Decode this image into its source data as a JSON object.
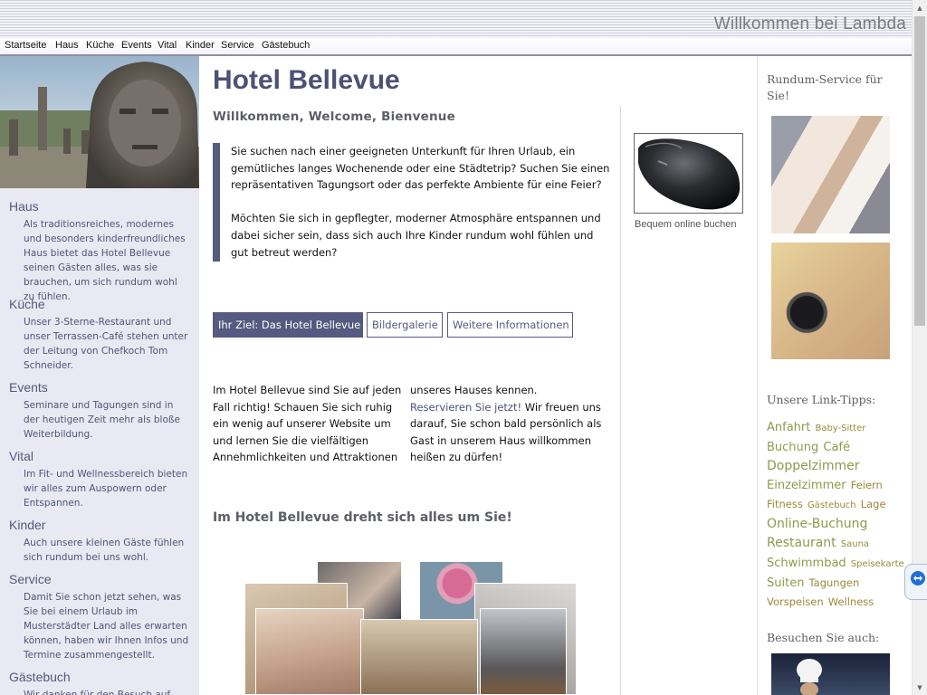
{
  "header": {
    "title": "Willkommen bei Lambda"
  },
  "topnav": [
    "Startseite",
    "Haus",
    "Küche",
    "Events",
    "Vital",
    "Kinder",
    "Service",
    "Gästebuch"
  ],
  "sidebar": {
    "sections": [
      {
        "title": "Haus",
        "text": "Als traditionsreiches, modernes und besonders kinderfreundliches Haus bietet das Hotel Bellevue seinen Gästen alles, was sie brauchen, um sich rundum wohl zu fühlen."
      },
      {
        "title": "Küche",
        "text": "Unser 3-Sterne-Restaurant und unser Terrassen-Café stehen unter der Leitung von Chefkoch Tom Schneider."
      },
      {
        "title": "Events",
        "text": "Seminare und Tagungen sind in der heutigen Zeit mehr als bloße Weiterbildung."
      },
      {
        "title": "Vital",
        "text": "Im Fit- und Wellnessbereich bieten wir alles zum Auspowern oder Entspannen."
      },
      {
        "title": "Kinder",
        "text": "Auch unsere kleinen Gäste fühlen sich rundum bei uns wohl."
      },
      {
        "title": "Service",
        "text": "Damit Sie schon jetzt sehen, was Sie bei einem Urlaub im Musterstädter Land alles erwarten können, haben wir Ihnen Infos und Termine zusammengestellt."
      },
      {
        "title": "Gästebuch",
        "text": "Wir danken für den Besuch auf"
      }
    ]
  },
  "main": {
    "title": "Hotel Bellevue",
    "subtitle": "Willkommen, Welcome, Bienvenue",
    "intro_p1": "Sie suchen nach einer geeigneten Unterkunft für Ihren Urlaub, ein gemütliches langes Wochenende oder eine Städtetrip? Suchen Sie einen repräsentativen Tagungsort oder das perfekte Ambiente für eine Feier?",
    "intro_p2": "Möchten Sie sich in gepflegter, moderner Atmosphäre entspannen und dabei sicher sein, dass sich auch Ihre Kinder rundum wohl fühlen und gut betreut werden?",
    "tabs": [
      "Ihr Ziel: Das Hotel Bellevue",
      "Bildergalerie",
      "Weitere Informationen"
    ],
    "col1": "Im Hotel Bellevue sind Sie auf jeden Fall richtig! Schauen Sie sich ruhig ein wenig auf unserer Website um und lernen Sie die vielfältigen Annehmlichkeiten und Attraktionen",
    "col2_a": "unseres Hauses kennen. ",
    "col2_link": "Reservieren Sie jetzt!",
    "col2_b": " Wir freuen uns darauf, Sie schon bald persönlich als Gast in unserem Haus willkommen heißen zu dürfen!",
    "heading2": "Im Hotel Bellevue dreht sich alles um Sie!",
    "booking_caption": "Bequem online buchen"
  },
  "right": {
    "service_title": "Rundum-Service für Sie!",
    "links_title": "Unsere Link-Tipps:",
    "tags": [
      {
        "text": "Anfahrt",
        "size": "l"
      },
      {
        "text": "Baby-Sitter",
        "size": "s"
      },
      {
        "text": "Buchung",
        "size": "l"
      },
      {
        "text": "Café",
        "size": "l"
      },
      {
        "text": "Doppelzimmer",
        "size": "xl"
      },
      {
        "text": "Einzelzimmer",
        "size": "l"
      },
      {
        "text": "Feiern",
        "size": "m"
      },
      {
        "text": "Fitness",
        "size": "m"
      },
      {
        "text": "Gästebuch",
        "size": "s"
      },
      {
        "text": "Lage",
        "size": "m"
      },
      {
        "text": "Online-Buchung",
        "size": "xl"
      },
      {
        "text": "Restaurant",
        "size": "xl"
      },
      {
        "text": "Sauna",
        "size": "s"
      },
      {
        "text": "Schwimmbad",
        "size": "l"
      },
      {
        "text": "Speisekarte",
        "size": "s"
      },
      {
        "text": "Suiten",
        "size": "l"
      },
      {
        "text": "Tagungen",
        "size": "m"
      },
      {
        "text": "Vorspeisen",
        "size": "m"
      },
      {
        "text": "Wellness",
        "size": "m"
      }
    ],
    "visit_title": "Besuchen Sie auch:"
  },
  "colors": {
    "accent": "#555a80",
    "sidebar_bg": "#e8e9f2",
    "tag_green": "#8f9a4a",
    "tag_gold": "#9a8a3a"
  }
}
